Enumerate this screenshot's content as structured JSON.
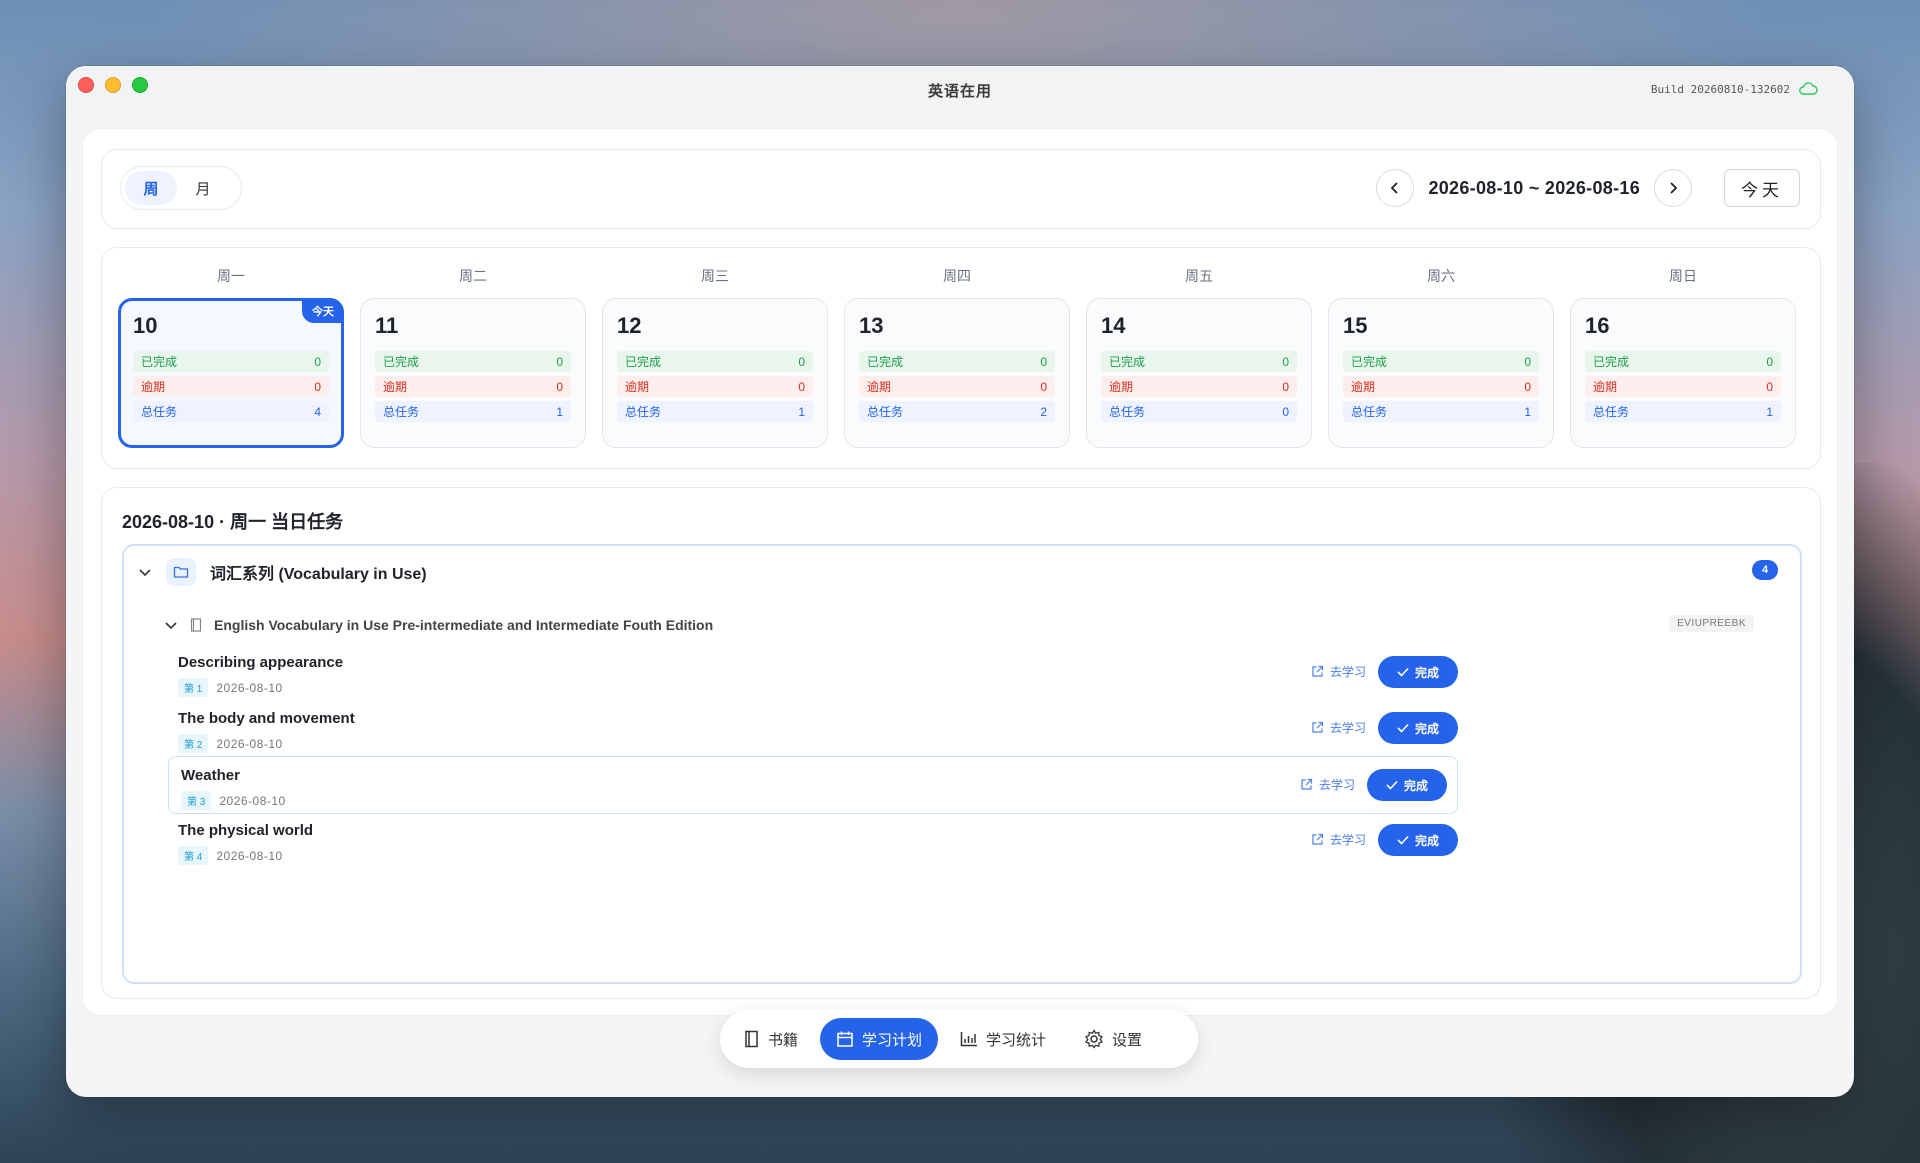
{
  "window": {
    "title": "英语在用",
    "build": "Build 20260810-132602"
  },
  "toolbar": {
    "view_week": "周",
    "view_month": "月",
    "date_range": "2026-08-10 ~ 2026-08-16",
    "today_button": "今天"
  },
  "week": {
    "stat_labels": {
      "done": "已完成",
      "overdue": "逾期",
      "total": "总任务"
    },
    "today_badge": "今天",
    "days": [
      {
        "weekday": "周一",
        "date": "10",
        "done": "0",
        "overdue": "0",
        "total": "4",
        "today": true
      },
      {
        "weekday": "周二",
        "date": "11",
        "done": "0",
        "overdue": "0",
        "total": "1",
        "today": false
      },
      {
        "weekday": "周三",
        "date": "12",
        "done": "0",
        "overdue": "0",
        "total": "1",
        "today": false
      },
      {
        "weekday": "周四",
        "date": "13",
        "done": "0",
        "overdue": "0",
        "total": "2",
        "today": false
      },
      {
        "weekday": "周五",
        "date": "14",
        "done": "0",
        "overdue": "0",
        "total": "0",
        "today": false
      },
      {
        "weekday": "周六",
        "date": "15",
        "done": "0",
        "overdue": "0",
        "total": "1",
        "today": false
      },
      {
        "weekday": "周日",
        "date": "16",
        "done": "0",
        "overdue": "0",
        "total": "1",
        "today": false
      }
    ]
  },
  "tasks": {
    "heading": "2026-08-10 · 周一 当日任务",
    "group": {
      "title": "词汇系列 (Vocabulary in Use)",
      "count": "4",
      "book": {
        "title": "English Vocabulary in Use Pre-intermediate and Intermediate Fouth Edition",
        "code": "EVIUPREEBK"
      },
      "items": [
        {
          "name": "Describing appearance",
          "seq": "第 1",
          "date": "2026-08-10"
        },
        {
          "name": "The body and movement",
          "seq": "第 2",
          "date": "2026-08-10"
        },
        {
          "name": "Weather",
          "seq": "第 3",
          "date": "2026-08-10"
        },
        {
          "name": "The physical world",
          "seq": "第 4",
          "date": "2026-08-10"
        }
      ],
      "study_label": "去学习",
      "done_label": "完成"
    }
  },
  "nav": {
    "books": "书籍",
    "plan": "学习计划",
    "stats": "学习统计",
    "settings": "设置"
  },
  "colors": {
    "accent": "#2563eb",
    "done": "#1f9d4c",
    "overdue": "#d92d20"
  }
}
